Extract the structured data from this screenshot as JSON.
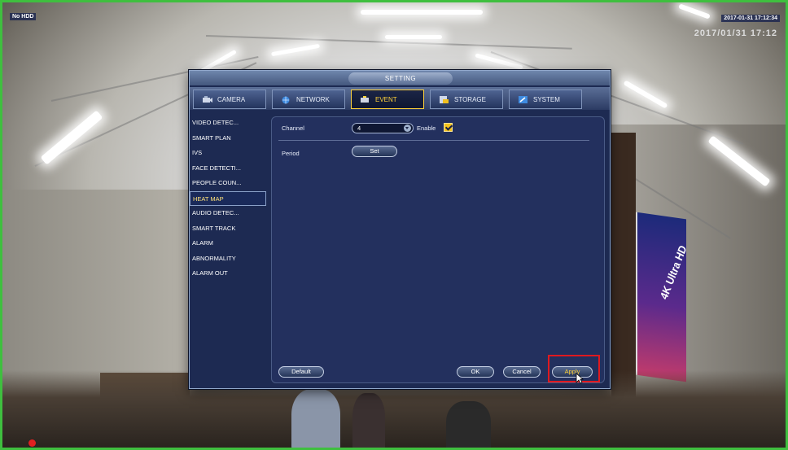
{
  "osd": {
    "top_left": "No HDD",
    "top_right": "2017-01-31 17:12:34",
    "top_right_second_line": "2017/01/31 17:12"
  },
  "camera_view": {
    "banner_text": "4K Ultra HD"
  },
  "dialog": {
    "title": "SETTING",
    "tabs": [
      {
        "label": "CAMERA",
        "icon": "camera-icon",
        "active": false
      },
      {
        "label": "NETWORK",
        "icon": "network-icon",
        "active": false
      },
      {
        "label": "EVENT",
        "icon": "event-icon",
        "active": true
      },
      {
        "label": "STORAGE",
        "icon": "storage-icon",
        "active": false
      },
      {
        "label": "SYSTEM",
        "icon": "system-icon",
        "active": false
      }
    ],
    "menu": [
      "VIDEO DETEC...",
      "SMART PLAN",
      "IVS",
      "FACE DETECTI...",
      "PEOPLE COUN...",
      "HEAT MAP",
      "AUDIO DETEC...",
      "SMART TRACK",
      "ALARM",
      "ABNORMALITY",
      "ALARM OUT"
    ],
    "active_menu_index": 5,
    "form": {
      "channel_label": "Channel",
      "channel_value": "4",
      "enable_label": "Enable",
      "enable_checked": true,
      "period_label": "Period",
      "set_button": "Set"
    },
    "buttons": {
      "default": "Default",
      "ok": "OK",
      "cancel": "Cancel",
      "apply": "Apply"
    }
  },
  "colors": {
    "accent": "#ffd23a",
    "dialog_bg": "#1d2a52",
    "highlight_box": "#e0191f"
  }
}
